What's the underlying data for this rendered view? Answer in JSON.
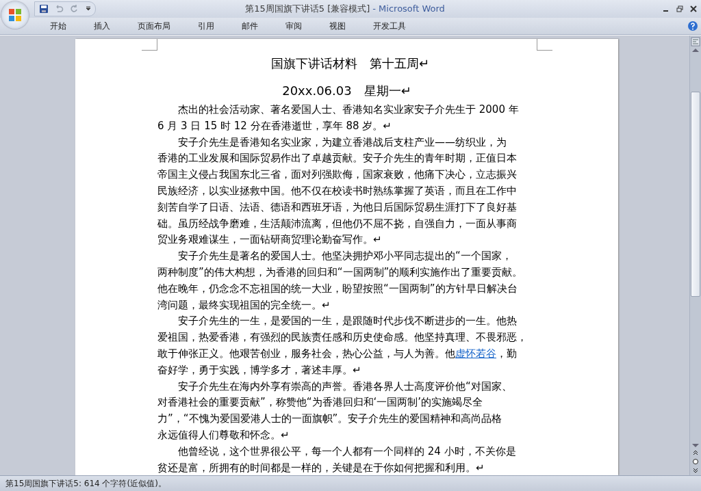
{
  "window": {
    "title": "第15周国旗下讲话5 [兼容模式]",
    "app_name": "- Microsoft Word"
  },
  "ribbon_tabs": [
    "开始",
    "插入",
    "页面布局",
    "引用",
    "邮件",
    "审阅",
    "视图",
    "开发工具"
  ],
  "document": {
    "title": "国旗下讲话材料　第十五周↵",
    "date": "20xx.06.03　星期一↵",
    "paragraphs": [
      {
        "lines": [
          "　　杰出的社会活动家、著名爱国人士、香港知名实业家安子介先生于 2000 年",
          "6 月 3 日 15 时 12 分在香港逝世，享年 88 岁。↵"
        ]
      },
      {
        "lines": [
          "　　安子介先生是香港知名实业家，为建立香港战后支柱产业——纺织业，为",
          "香港的工业发展和国际贸易作出了卓越贡献。安子介先生的青年时期，正值日本",
          "帝国主义侵占我国东北三省，面对列强欺侮，国家衰败，他痛下决心，立志振兴",
          "民族经济，以实业拯救中国。他不仅在校读书时熟练掌握了英语，而且在工作中",
          "刻苦自学了日语、法语、德语和西班牙语，为他日后国际贸易生涯打下了良好基",
          "础。虽历经战争磨难，生活颠沛流离，但他仍不屈不挠，自强自力，一面从事商",
          "贸业务艰难谋生，一面钻研商贸理论勤奋写作。↵"
        ]
      },
      {
        "lines": [
          "　　安子介先生是著名的爱国人士。他坚决拥护邓小平同志提出的“一个国家，",
          "两种制度”的伟大构想，为香港的回归和“一国两制”的顺利实施作出了重要贡献。",
          "他在晚年，仍念念不忘祖国的统一大业，盼望按照“一国两制”的方针早日解决台",
          "湾问题，最终实现祖国的完全统一。↵"
        ]
      },
      {
        "lines": [
          "　　安子介先生的一生，是爱国的一生，是跟随时代步伐不断进步的一生。他热",
          "爱祖国，热爱香港，有强烈的民族责任感和历史使命感。他坚持真理、不畏邪恶，",
          [
            {
              "text": "敢于伸张正义。他艰苦创业，服务社会，热心公益，与人为善。他"
            },
            {
              "text": "虚怀若谷",
              "kind": "link"
            },
            {
              "text": "，勤"
            }
          ],
          "奋好学，勇于实践，博学多才，著述丰厚。↵"
        ]
      },
      {
        "lines": [
          "　　安子介先生在海内外享有崇高的声誉。香港各界人士高度评价他“对国家、",
          "对香港社会的重要贡献”，称赞他“为香港回归和‘一国两制’的实施竭尽全",
          "力”，“不愧为爱国爱港人士的一面旗帜”。安子介先生的爱国精神和高尚品格",
          "永远值得人们尊敬和怀念。↵"
        ]
      },
      {
        "lines": [
          "　　他曾经说，这个世界很公平，每一个人都有一个同样的 24 小时，不关你是",
          "贫还是富，所拥有的时间都是一样的，关键是在于你如何把握和利用。↵"
        ]
      }
    ]
  },
  "status_bar": "第15周国旗下讲话5: 614 个字符(近似值)。"
}
